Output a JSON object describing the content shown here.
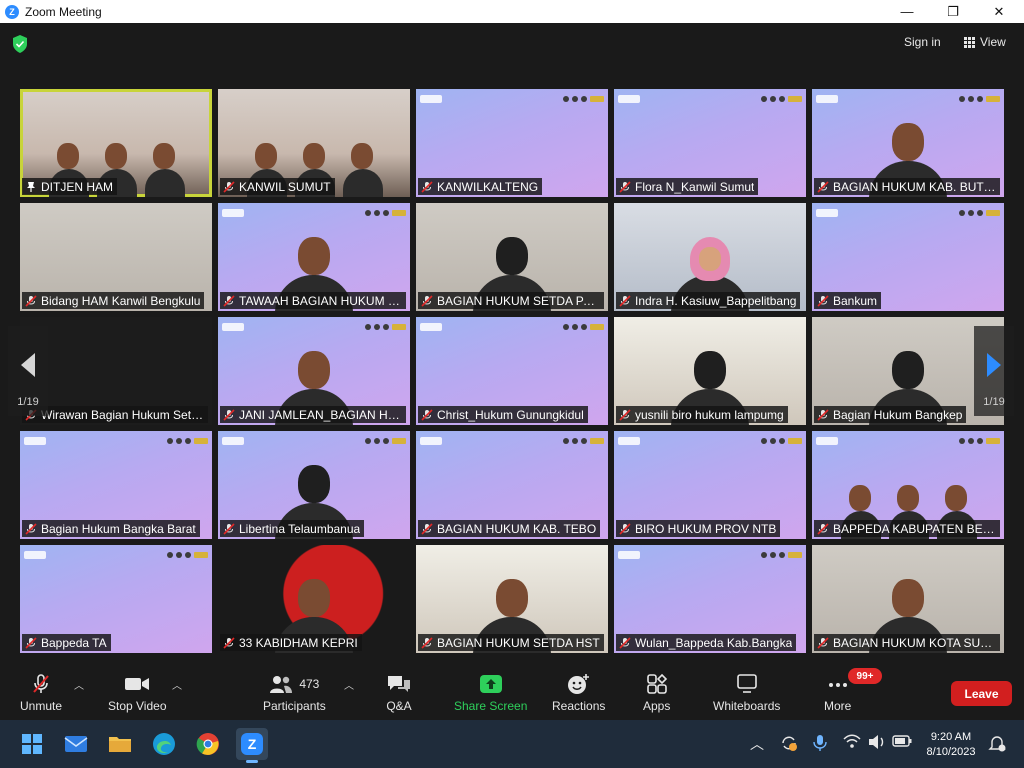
{
  "window": {
    "title": "Zoom Meeting",
    "logo_letter": "Z",
    "minimize": "—",
    "maximize": "❐",
    "close": "✕"
  },
  "header": {
    "sign_in": "Sign in",
    "view": "View"
  },
  "pager": {
    "left_page": "1/19",
    "right_page": "1/19"
  },
  "participants": [
    {
      "name": "DITJEN HAM",
      "muted": false,
      "bg": "room",
      "person": "group"
    },
    {
      "name": "KANWIL SUMUT",
      "muted": true,
      "bg": "room",
      "person": "group2"
    },
    {
      "name": "KANWILKALTENG",
      "muted": true,
      "bg": "purple",
      "person": ""
    },
    {
      "name": "Flora N_Kanwil Sumut",
      "muted": true,
      "bg": "purple",
      "person": ""
    },
    {
      "name": "BAGIAN HUKUM KAB. BUTON SELATAN",
      "muted": true,
      "bg": "purple",
      "person": "man"
    },
    {
      "name": "Bidang HAM Kanwil Bengkulu",
      "muted": true,
      "bg": "wall",
      "person": ""
    },
    {
      "name": "TAWAAH BAGIAN HUKUM KAB. SORONG",
      "muted": true,
      "bg": "purple",
      "person": "man"
    },
    {
      "name": "BAGIAN HUKUM SETDA PAPUA",
      "muted": true,
      "bg": "wall",
      "person": "woman"
    },
    {
      "name": "Indra H. Kasiuw_Bappelitbang",
      "muted": true,
      "bg": "office",
      "person": "hijab"
    },
    {
      "name": "Bankum",
      "muted": true,
      "bg": "purple",
      "person": ""
    },
    {
      "name": "Wirawan Bagian Hukum Setda",
      "muted": true,
      "bg": "dark",
      "person": ""
    },
    {
      "name": "JANI JAMLEAN_BAGIAN HUKUM",
      "muted": true,
      "bg": "purple",
      "person": "man"
    },
    {
      "name": "Christ_Hukum Gunungkidul",
      "muted": true,
      "bg": "purple",
      "person": ""
    },
    {
      "name": "yusnili biro hukum lampumg",
      "muted": true,
      "bg": "window",
      "person": "woman"
    },
    {
      "name": "Bagian Hukum Bangkep",
      "muted": true,
      "bg": "wall",
      "person": "woman"
    },
    {
      "name": "Bagian Hukum Bangka Barat",
      "muted": true,
      "bg": "purple",
      "person": ""
    },
    {
      "name": "Libertina Telaumbanua",
      "muted": true,
      "bg": "purple",
      "person": "woman"
    },
    {
      "name": "BAGIAN HUKUM KAB. TEBO",
      "muted": true,
      "bg": "purple",
      "person": ""
    },
    {
      "name": "BIRO HUKUM PROV NTB",
      "muted": true,
      "bg": "purple",
      "person": ""
    },
    {
      "name": "BAPPEDA KABUPATEN BENGKULU",
      "muted": true,
      "bg": "purple",
      "person": "group"
    },
    {
      "name": "Bappeda TA",
      "muted": true,
      "bg": "purple",
      "person": ""
    },
    {
      "name": "33 KABIDHAM KEPRI",
      "muted": true,
      "bg": "redbg",
      "person": "man"
    },
    {
      "name": "BAGIAN HUKUM SETDA HST",
      "muted": true,
      "bg": "window",
      "person": "man"
    },
    {
      "name": "Wulan_Bappeda Kab.Bangka",
      "muted": true,
      "bg": "purple",
      "person": ""
    },
    {
      "name": "BAGIAN HUKUM KOTA SUKABUMI",
      "muted": true,
      "bg": "wall",
      "person": "man"
    }
  ],
  "toolbar": {
    "unmute": "Unmute",
    "stop_video": "Stop Video",
    "participants": "Participants",
    "participants_count": "473",
    "qa": "Q&A",
    "share_screen": "Share Screen",
    "reactions": "Reactions",
    "apps": "Apps",
    "whiteboards": "Whiteboards",
    "more": "More",
    "more_badge": "99+",
    "leave": "Leave"
  },
  "taskbar": {
    "time": "9:20 AM",
    "date": "8/10/2023"
  },
  "colors": {
    "accent": "#2d8cff",
    "share_green": "#2ecf5b",
    "leave_red": "#d21f1f",
    "active_border": "#c8d43a"
  }
}
